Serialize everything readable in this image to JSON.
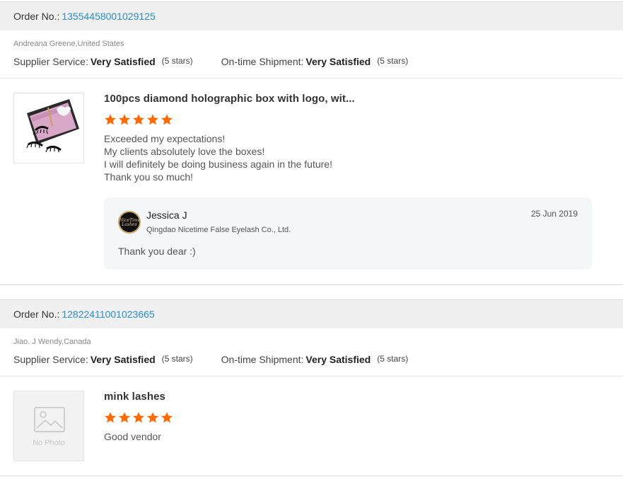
{
  "reviews": [
    {
      "order_label": "Order No.:",
      "order_number": "13554458001029125",
      "buyer": "Andreana Greene,United States",
      "supplier_label": "Supplier Service:",
      "supplier_value": "Very Satisfied",
      "supplier_stars": "(5 stars)",
      "shipment_label": "On-time Shipment:",
      "shipment_value": "Very Satisfied",
      "shipment_stars": "(5 stars)",
      "product_title": "100pcs diamond holographic box with logo, wit...",
      "rating": 5,
      "comment": [
        "Exceeded my expectations!",
        "My clients absolutely love the boxes!",
        "I will definitely be doing business again in the future!",
        "Thank you so much!"
      ],
      "reply": {
        "avatar_text": "NiceTime Lashes",
        "name": "Jessica J",
        "company": "Qingdao Nicetime False Eyelash Co., Ltd.",
        "date": "25 Jun 2019",
        "text": "Thank you dear :)"
      }
    },
    {
      "order_label": "Order No.:",
      "order_number": "12822411001023665",
      "buyer": "Jiao. J Wendy,Canada",
      "supplier_label": "Supplier Service:",
      "supplier_value": "Very Satisfied",
      "supplier_stars": "(5 stars)",
      "shipment_label": "On-time Shipment:",
      "shipment_value": "Very Satisfied",
      "shipment_stars": "(5 stars)",
      "product_title": "mink lashes",
      "rating": 5,
      "comment": [
        "Good vendor"
      ],
      "no_photo_label": "No Photo"
    }
  ],
  "colors": {
    "link": "#2a8fce",
    "star": "#ff6a00"
  },
  "icons": {
    "star": "star-icon",
    "no_photo": "image-placeholder-icon"
  }
}
